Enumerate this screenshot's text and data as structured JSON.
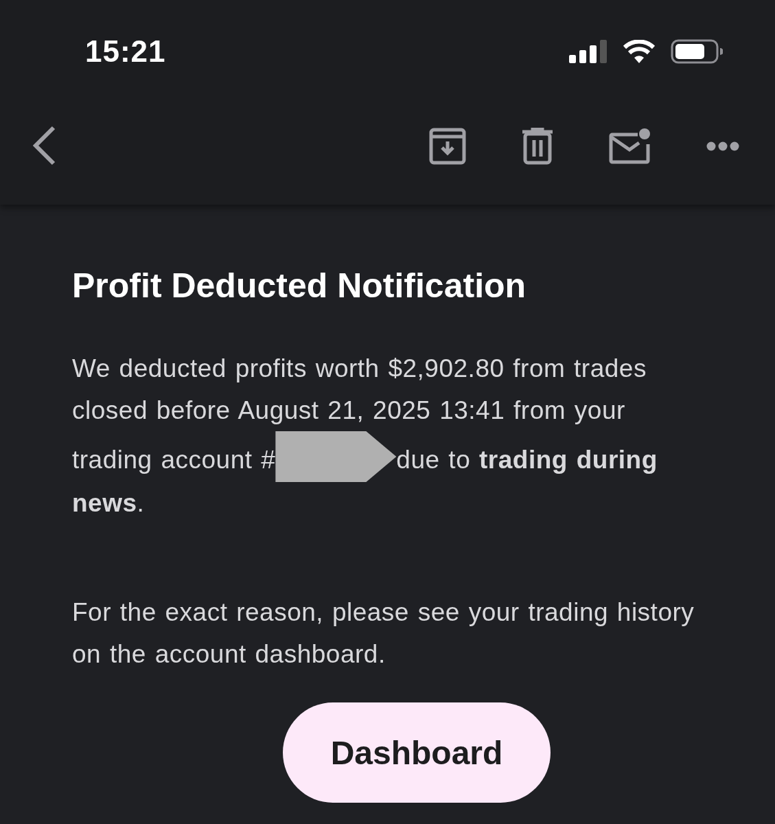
{
  "status_bar": {
    "time": "15:21"
  },
  "toolbar": {
    "actions": [
      {
        "kind": "archive"
      },
      {
        "kind": "delete"
      },
      {
        "kind": "unread"
      },
      {
        "kind": "more"
      }
    ]
  },
  "email": {
    "heading": "Profit Deducted Notification",
    "paragraphs": [
      {
        "parts": [
          {
            "kind": "text",
            "text": "We deducted profits worth $2,902.80 from trades closed before August 21, 2025 13:41 from your trading account #"
          },
          {
            "kind": "redaction"
          },
          {
            "kind": "text",
            "text": "due to **trading during news**."
          }
        ]
      },
      {
        "parts": [
          {
            "kind": "text",
            "text": "For the exact reason, please see your trading history on the account dashboard."
          }
        ]
      }
    ],
    "button": "Dashboard"
  }
}
